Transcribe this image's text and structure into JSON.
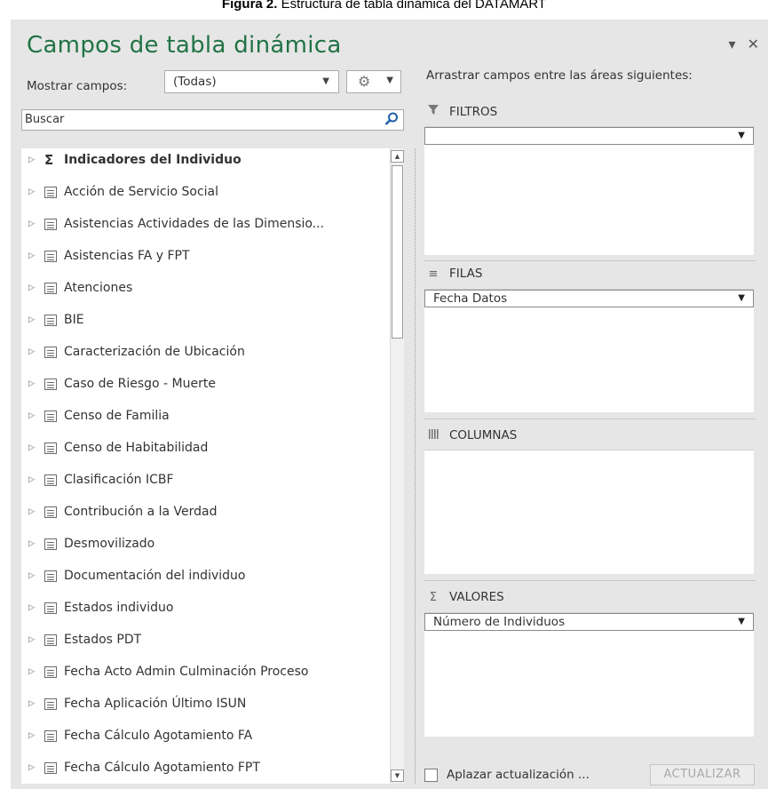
{
  "caption": {
    "bold": "Figura 2.",
    "text": " Estructura de tabla dinámica del DATAMART"
  },
  "panel": {
    "title": "Campos de tabla dinámica",
    "dropdown_icon": "▾",
    "close_icon": "✕",
    "show_fields_label": "Mostrar campos:",
    "show_fields_value": "(Todas)",
    "search_placeholder": "Buscar",
    "drag_hint": "Arrastrar campos entre las áreas siguientes:"
  },
  "fields": [
    {
      "label": "Indicadores del Individuo",
      "icon": "sigma-icon",
      "bold": true
    },
    {
      "label": "Acción de Servicio Social",
      "icon": "table-icon"
    },
    {
      "label": "Asistencias Actividades de las Dimensio...",
      "icon": "table-icon"
    },
    {
      "label": "Asistencias FA y FPT",
      "icon": "table-icon"
    },
    {
      "label": "Atenciones",
      "icon": "table-icon"
    },
    {
      "label": "BIE",
      "icon": "table-icon"
    },
    {
      "label": "Caracterización de Ubicación",
      "icon": "table-icon"
    },
    {
      "label": "Caso de Riesgo - Muerte",
      "icon": "table-icon"
    },
    {
      "label": "Censo de Familia",
      "icon": "table-icon"
    },
    {
      "label": "Censo de Habitabilidad",
      "icon": "table-icon"
    },
    {
      "label": "Clasificación ICBF",
      "icon": "table-icon"
    },
    {
      "label": "Contribución a la Verdad",
      "icon": "table-icon"
    },
    {
      "label": "Desmovilizado",
      "icon": "table-icon"
    },
    {
      "label": "Documentación del individuo",
      "icon": "table-icon"
    },
    {
      "label": "Estados individuo",
      "icon": "table-icon"
    },
    {
      "label": "Estados PDT",
      "icon": "table-icon"
    },
    {
      "label": "Fecha Acto Admin Culminación Proceso",
      "icon": "table-icon"
    },
    {
      "label": "Fecha Aplicación Último ISUN",
      "icon": "table-icon"
    },
    {
      "label": "Fecha Cálculo Agotamiento FA",
      "icon": "table-icon"
    },
    {
      "label": "Fecha Cálculo Agotamiento FPT",
      "icon": "table-icon"
    }
  ],
  "areas": {
    "filters": {
      "label": "FILTROS",
      "field": ""
    },
    "rows": {
      "label": "FILAS",
      "field": "Fecha Datos"
    },
    "columns": {
      "label": "COLUMNAS"
    },
    "values": {
      "label": "VALORES",
      "field": "Número de Individuos"
    }
  },
  "footer": {
    "defer_label": "Aplazar actualización ...",
    "update_button": "ACTUALIZAR"
  },
  "colors": {
    "title": "#217346",
    "panel_bg": "#e6e6e6"
  }
}
